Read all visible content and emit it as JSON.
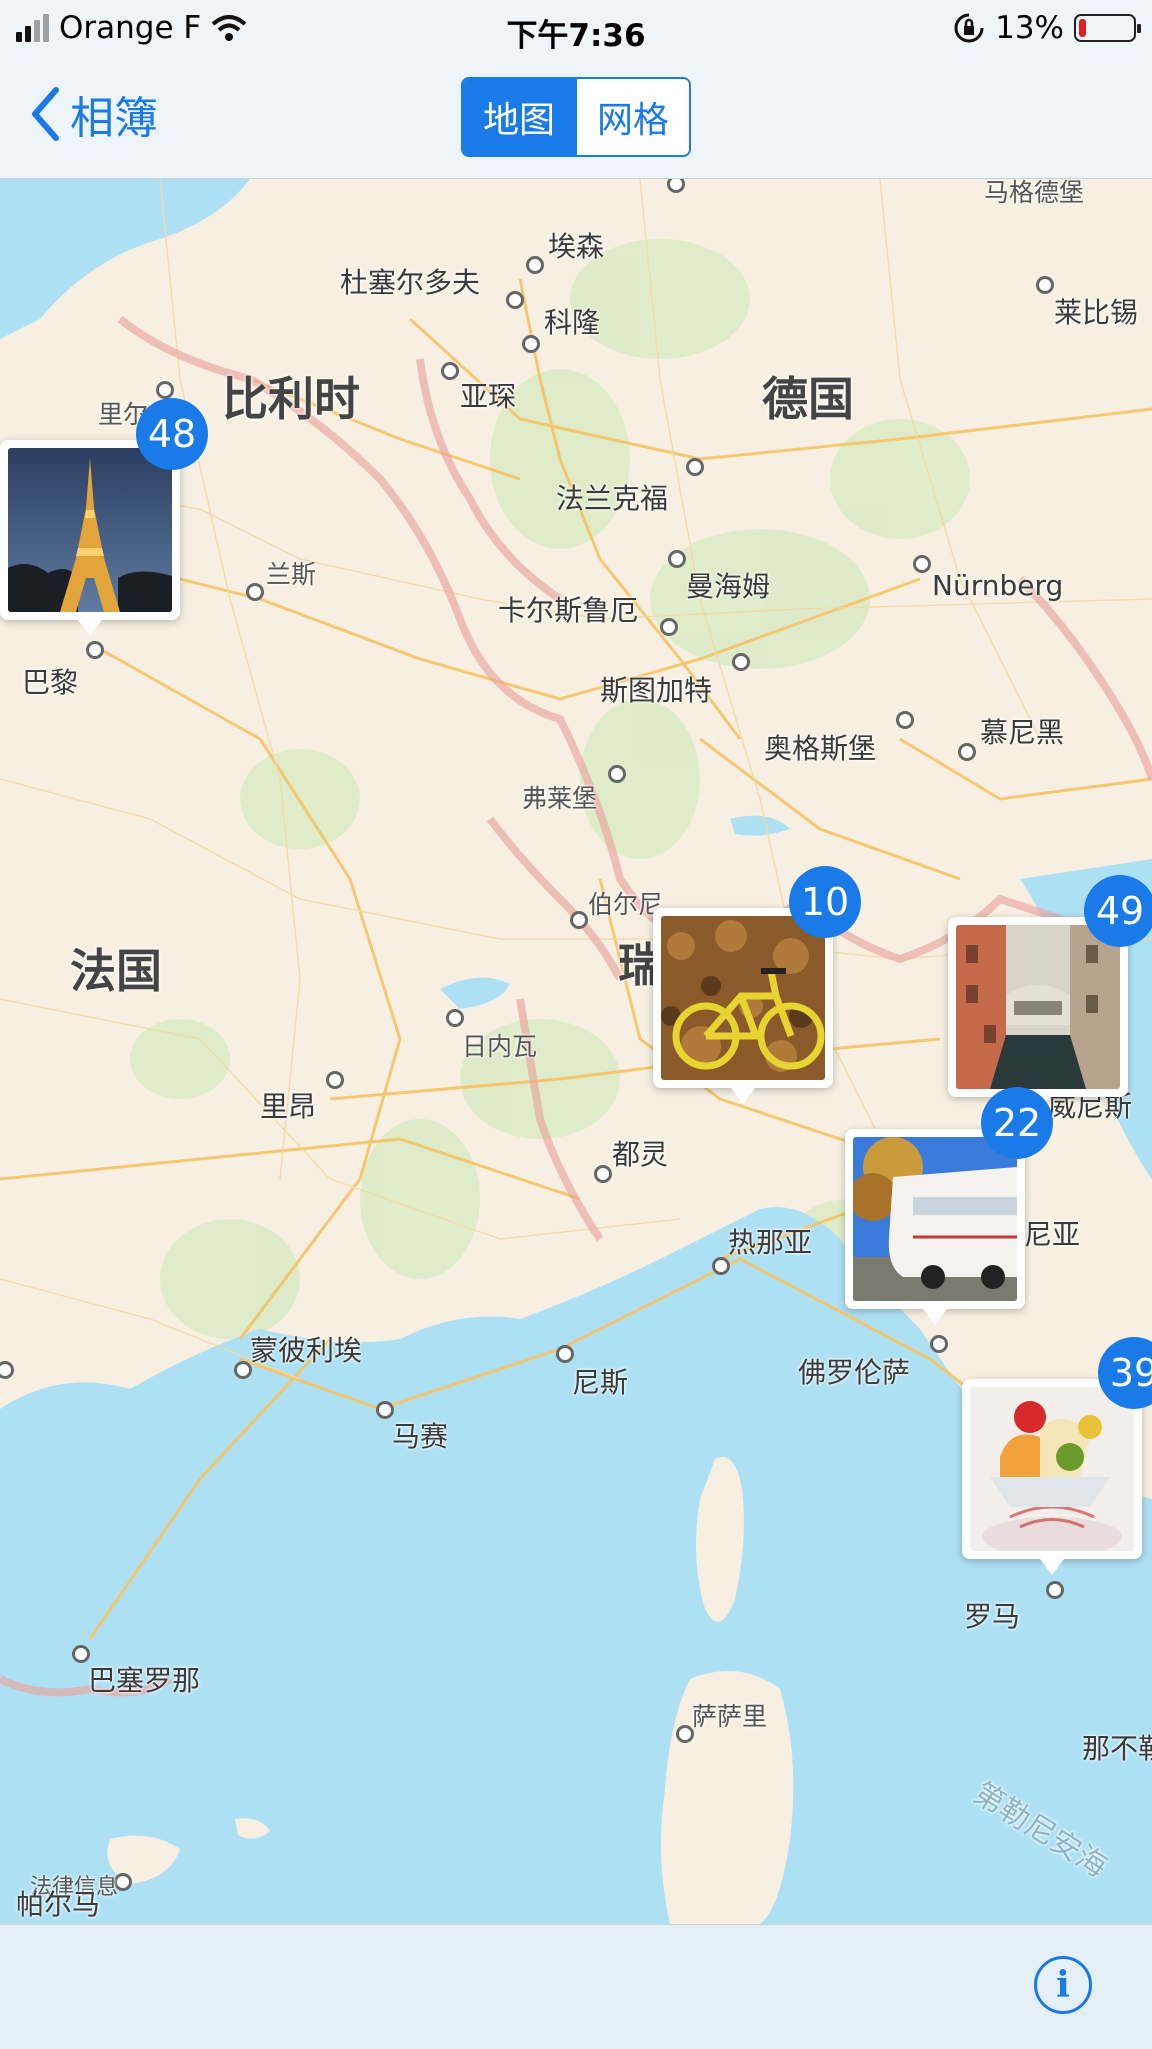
{
  "status": {
    "carrier": "Orange F",
    "time": "下午7:36",
    "battery": "13%",
    "battery_level": 0.13
  },
  "nav": {
    "back_label": "相簿",
    "segments": [
      "地图",
      "网格"
    ],
    "selected_segment": "地图"
  },
  "map": {
    "countries": [
      "比利时",
      "德国",
      "法国"
    ],
    "cities": [
      "马格德堡",
      "埃森",
      "杜塞尔多夫",
      "科隆",
      "莱比锡",
      "亚琛",
      "里尔",
      "法兰克福",
      "兰斯",
      "曼海姆",
      "Nürnberg",
      "卡尔斯鲁厄",
      "巴黎",
      "斯图加特",
      "奥格斯堡",
      "慕尼黑",
      "弗莱堡",
      "伯尔尼",
      "瑞",
      "日内瓦",
      "里昂",
      "威尼斯",
      "都灵",
      "热那亚",
      "尼亚",
      "蒙彼利埃",
      "尼斯",
      "佛罗伦萨",
      "马赛",
      "罗马",
      "巴塞罗那",
      "萨萨里",
      "那不勒",
      "第勒尼安海",
      "法律信息",
      "帕尔马"
    ]
  },
  "photo_clusters": [
    {
      "count": "48",
      "subject": "eiffel-tower-night"
    },
    {
      "count": "10",
      "subject": "yellow-bicycle-leaves"
    },
    {
      "count": "49",
      "subject": "venice-canal-bridge"
    },
    {
      "count": "22",
      "subject": "white-tour-bus"
    },
    {
      "count": "39",
      "subject": "fruit-dessert"
    }
  ],
  "colors": {
    "accent": "#1a7ae8",
    "land": "#f7f0e2",
    "water": "#aee0f4",
    "road": "#f5c56a",
    "border": "#e8a4a0"
  }
}
